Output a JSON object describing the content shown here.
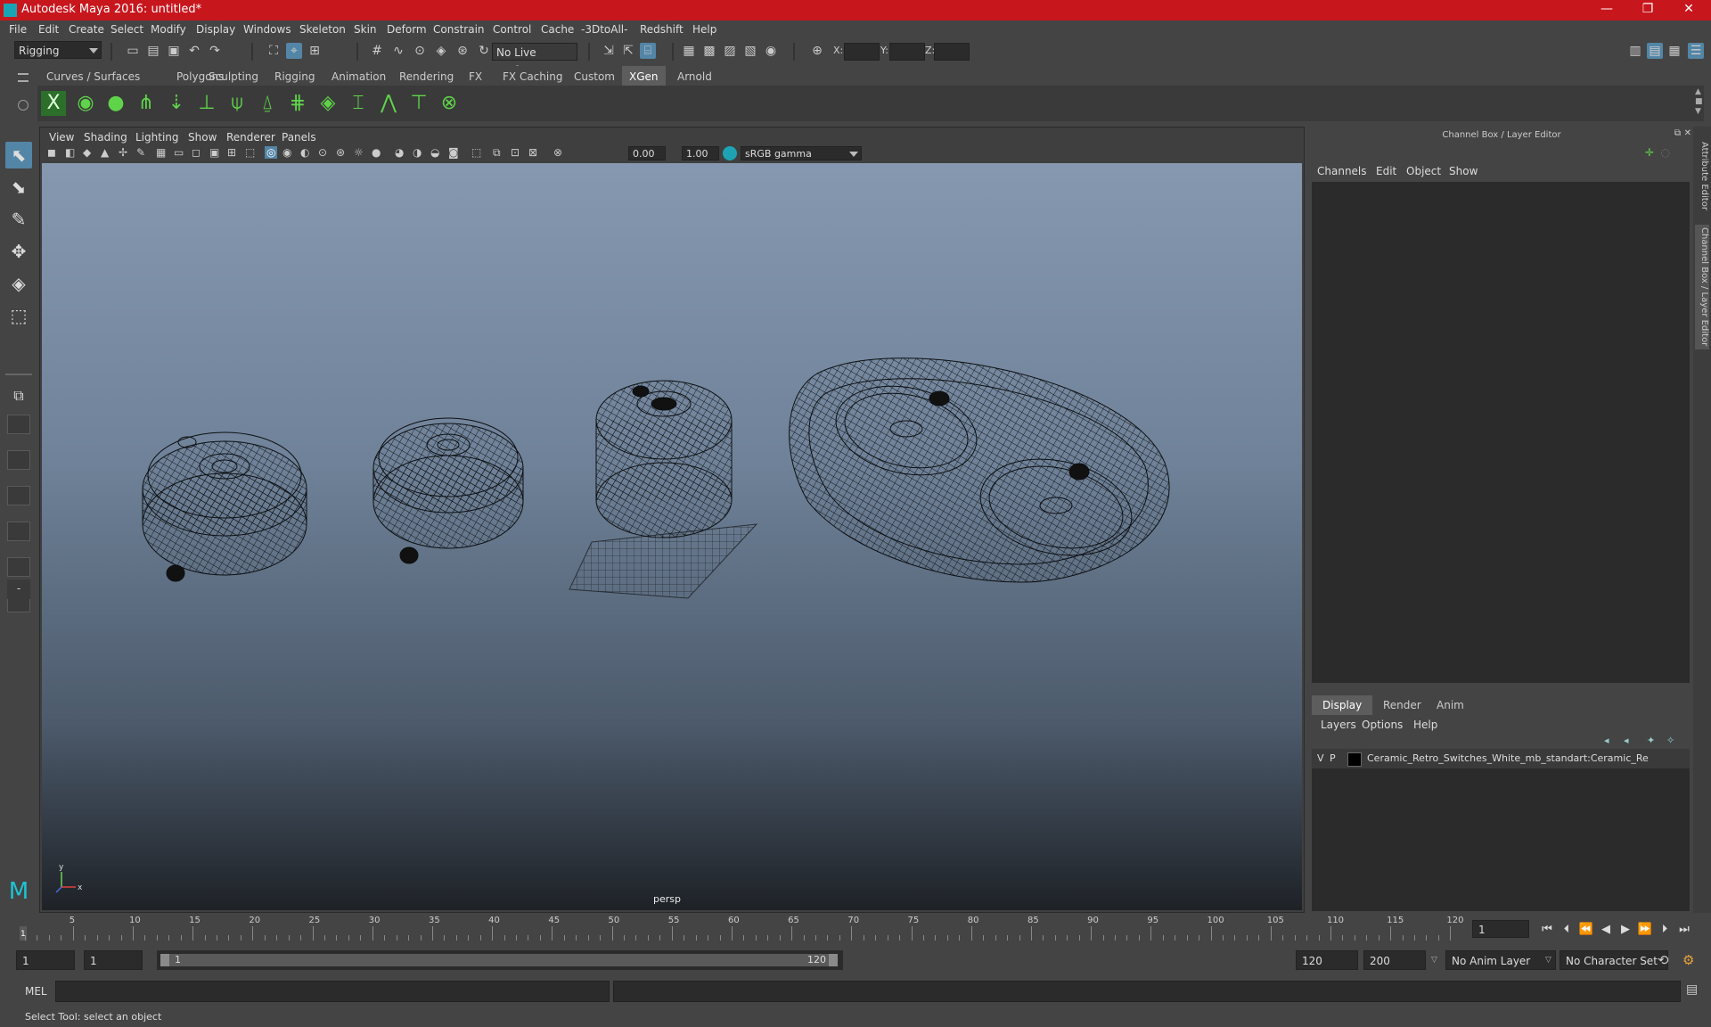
{
  "window": {
    "title": "Autodesk Maya 2016: untitled*",
    "minimize": "—",
    "maximize": "❐",
    "close": "✕"
  },
  "menubar": [
    "File",
    "Edit",
    "Create",
    "Select",
    "Modify",
    "Display",
    "Windows",
    "Skeleton",
    "Skin",
    "Deform",
    "Constrain",
    "Control",
    "Cache",
    "-3DtoAll-",
    "Redshift",
    "Help"
  ],
  "statusline": {
    "menu_set": "Rigging",
    "live_surface": "No Live Surface",
    "x_label": "X:",
    "y_label": "Y:",
    "z_label": "Z:"
  },
  "shelf_tabs": [
    "Curves / Surfaces",
    "Polygons",
    "Sculpting",
    "Rigging",
    "Animation",
    "Rendering",
    "FX",
    "FX Caching",
    "Custom",
    "XGen",
    "Arnold"
  ],
  "active_shelf_tab": "XGen",
  "viewport": {
    "menu": [
      "View",
      "Shading",
      "Lighting",
      "Show",
      "Renderer",
      "Panels"
    ],
    "exposure": "0.00",
    "gamma": "1.00",
    "color_space": "sRGB gamma",
    "camera": "persp",
    "axis_y": "y",
    "axis_x": "x"
  },
  "channel_box": {
    "header": "Channel Box / Layer Editor",
    "menu": [
      "Channels",
      "Edit",
      "Object",
      "Show"
    ]
  },
  "layer_editor": {
    "tabs": [
      "Display",
      "Render",
      "Anim"
    ],
    "active_tab": "Display",
    "menu": [
      "Layers",
      "Options",
      "Help"
    ],
    "layers": [
      {
        "v": "V",
        "p": "P",
        "name": "Ceramic_Retro_Switches_White_mb_standart:Ceramic_Re"
      }
    ]
  },
  "side_tabs": [
    "Attribute Editor",
    "Channel Box / Layer Editor"
  ],
  "time_slider": {
    "labels": [
      "5",
      "10",
      "15",
      "20",
      "25",
      "30",
      "35",
      "40",
      "45",
      "50",
      "55",
      "60",
      "65",
      "70",
      "75",
      "80",
      "85",
      "90",
      "95",
      "100",
      "105",
      "110",
      "115",
      "120"
    ],
    "current_marker": "1",
    "current_frame": "1"
  },
  "range_slider": {
    "start_frame": "1",
    "playback_start": "1",
    "range_start_label": "1",
    "range_end_label": "120",
    "playback_end": "120",
    "end_frame": "200",
    "anim_layer": "No Anim Layer",
    "character_set": "No Character Set"
  },
  "command_line": {
    "lang": "MEL"
  },
  "help_line": "Select Tool: select an object",
  "colors": {
    "titlebar": "#c8161d",
    "highlight": "#5285a6",
    "shelf_icon": "#5fd34a"
  }
}
